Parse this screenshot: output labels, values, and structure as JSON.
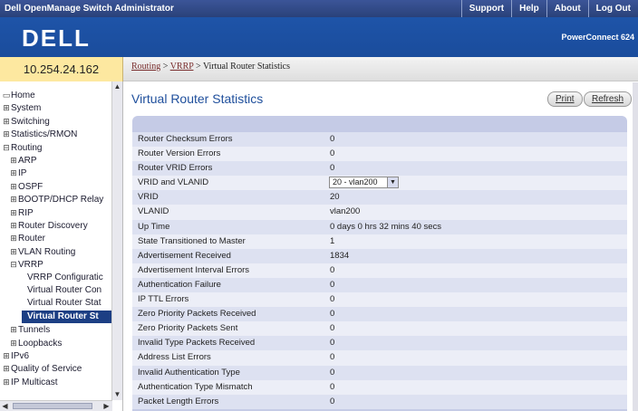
{
  "topbar": {
    "app_title": "Dell OpenManage Switch Administrator",
    "menu": [
      "Support",
      "Help",
      "About",
      "Log Out"
    ]
  },
  "banner": {
    "logo": "DELL",
    "product": "PowerConnect 624"
  },
  "ip_address": "10.254.24.162",
  "breadcrumb": {
    "link1": "Routing",
    "link2": "VRRP",
    "current": "Virtual Router Statistics",
    "sep": ">"
  },
  "sidebar": {
    "items": [
      {
        "label": "Home",
        "glyph": "▭",
        "indent": 0
      },
      {
        "label": "System",
        "glyph": "⊞",
        "indent": 0
      },
      {
        "label": "Switching",
        "glyph": "⊞",
        "indent": 0
      },
      {
        "label": "Statistics/RMON",
        "glyph": "⊞",
        "indent": 0
      },
      {
        "label": "Routing",
        "glyph": "⊟",
        "indent": 0
      },
      {
        "label": "ARP",
        "glyph": "⊞",
        "indent": 1
      },
      {
        "label": "IP",
        "glyph": "⊞",
        "indent": 1
      },
      {
        "label": "OSPF",
        "glyph": "⊞",
        "indent": 1
      },
      {
        "label": "BOOTP/DHCP Relay",
        "glyph": "⊞",
        "indent": 1
      },
      {
        "label": "RIP",
        "glyph": "⊞",
        "indent": 1
      },
      {
        "label": "Router Discovery",
        "glyph": "⊞",
        "indent": 1
      },
      {
        "label": "Router",
        "glyph": "⊞",
        "indent": 1
      },
      {
        "label": "VLAN Routing",
        "glyph": "⊞",
        "indent": 1
      },
      {
        "label": "VRRP",
        "glyph": "⊟",
        "indent": 1
      },
      {
        "label": "VRRP Configuratic",
        "glyph": "",
        "indent": 2
      },
      {
        "label": "Virtual Router Con",
        "glyph": "",
        "indent": 2
      },
      {
        "label": "Virtual Router Stat",
        "glyph": "",
        "indent": 2
      },
      {
        "label": "Virtual Router St",
        "glyph": "",
        "indent": 2,
        "selected": true
      },
      {
        "label": "Tunnels",
        "glyph": "⊞",
        "indent": 1
      },
      {
        "label": "Loopbacks",
        "glyph": "⊞",
        "indent": 1
      },
      {
        "label": "IPv6",
        "glyph": "⊞",
        "indent": 0
      },
      {
        "label": "Quality of Service",
        "glyph": "⊞",
        "indent": 0
      },
      {
        "label": "IP Multicast",
        "glyph": "⊞",
        "indent": 0
      }
    ]
  },
  "main": {
    "title": "Virtual Router Statistics",
    "print_label": "Print",
    "refresh_label": "Refresh",
    "rows": [
      {
        "label": "Router Checksum Errors",
        "value": "0"
      },
      {
        "label": "Router Version Errors",
        "value": "0"
      },
      {
        "label": "Router VRID Errors",
        "value": "0"
      },
      {
        "label": "VRID and VLANID",
        "value": "20 - vlan200",
        "select": true
      },
      {
        "label": "VRID",
        "value": "20"
      },
      {
        "label": "VLANID",
        "value": "vlan200"
      },
      {
        "label": "Up Time",
        "value": "0 days 0 hrs 32 mins 40 secs"
      },
      {
        "label": "State Transitioned to Master",
        "value": "1"
      },
      {
        "label": "Advertisement Received",
        "value": "1834"
      },
      {
        "label": "Advertisement Interval Errors",
        "value": "0"
      },
      {
        "label": "Authentication Failure",
        "value": "0"
      },
      {
        "label": "IP TTL Errors",
        "value": "0"
      },
      {
        "label": "Zero Priority Packets Received",
        "value": "0"
      },
      {
        "label": "Zero Priority Packets Sent",
        "value": "0"
      },
      {
        "label": "Invalid Type Packets Received",
        "value": "0"
      },
      {
        "label": "Address List Errors",
        "value": "0"
      },
      {
        "label": "Invalid Authentication Type",
        "value": "0"
      },
      {
        "label": "Authentication Type Mismatch",
        "value": "0"
      },
      {
        "label": "Packet Length Errors",
        "value": "0"
      }
    ]
  }
}
